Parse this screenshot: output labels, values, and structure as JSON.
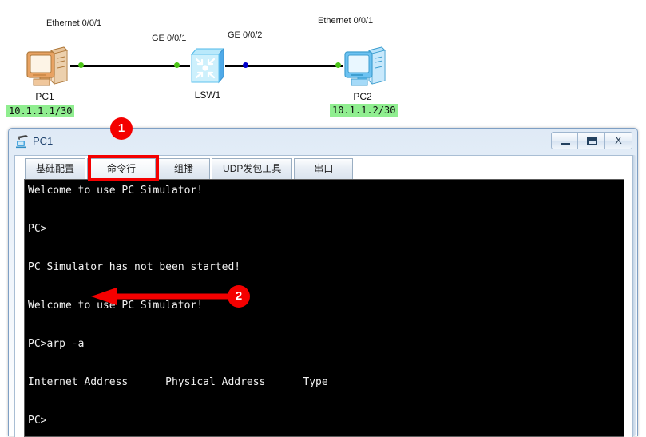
{
  "topology": {
    "devices": [
      {
        "id": "pc1",
        "name": "PC1",
        "icon": "pc-desktop-orange-icon",
        "ip": "10.1.1.1/30",
        "port_label": "Ethernet 0/0/1"
      },
      {
        "id": "lsw1",
        "name": "LSW1",
        "icon": "switch-icon",
        "ip": "",
        "port_label": "GE 0/0/1"
      },
      {
        "id": "pc2",
        "name": "PC2",
        "icon": "pc-desktop-blue-icon",
        "ip": "10.1.1.2/30",
        "port_label": "Ethernet 0/0/1"
      }
    ],
    "extra_port_label": "GE 0/0/2",
    "link_status": {
      "pc1_side": "up",
      "lsw1_ge001": "up",
      "lsw1_ge002": "down",
      "pc2_side": "up"
    },
    "colors": {
      "link_up": "#4cc417",
      "link_down": "#0000cc",
      "ip_badge_bg": "#90ee90",
      "link_line": "#000000"
    }
  },
  "callouts": [
    {
      "number": "1",
      "target": "tab-command-line"
    },
    {
      "number": "2",
      "target": "console-command-arp"
    }
  ],
  "window": {
    "title": "PC1",
    "icon": "pc-window-icon",
    "buttons": {
      "minimize": {
        "name": "minimize-button",
        "label": ""
      },
      "maximize": {
        "name": "maximize-button",
        "label": ""
      },
      "close": {
        "name": "close-button",
        "label": "X"
      }
    }
  },
  "tabs": [
    {
      "id": "basic-config",
      "label": "基础配置",
      "selected": false
    },
    {
      "id": "command-line",
      "label": "命令行",
      "selected": true
    },
    {
      "id": "multicast",
      "label": "组播",
      "selected": false
    },
    {
      "id": "udp-tool",
      "label": "UDP发包工具",
      "selected": false
    },
    {
      "id": "serial-port",
      "label": "串口",
      "selected": false
    }
  ],
  "console": {
    "text": "Welcome to use PC Simulator!\n\nPC>\n\nPC Simulator has not been started!\n\nWelcome to use PC Simulator!\n\nPC>arp -a\n\nInternet Address      Physical Address      Type\n\nPC>",
    "prompt": "PC>",
    "last_command": "arp -a",
    "table_headers": [
      "Internet Address",
      "Physical Address",
      "Type"
    ],
    "colors": {
      "bg": "#000000",
      "fg": "#f2f2f2"
    }
  }
}
